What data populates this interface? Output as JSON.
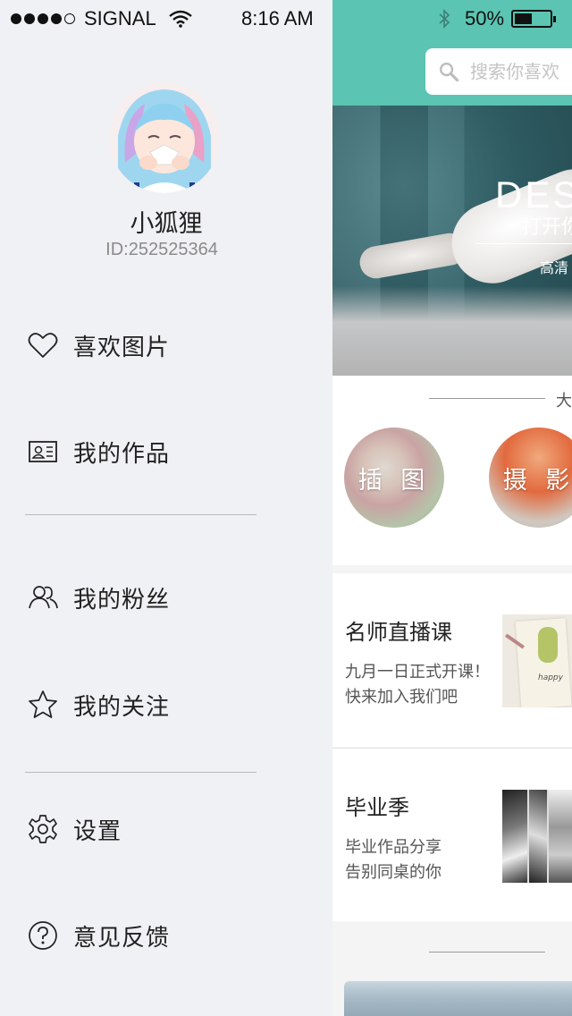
{
  "status_bar": {
    "carrier": "SIGNAL",
    "time": "8:16 AM",
    "battery": "50%",
    "battery_level": 0.5
  },
  "drawer": {
    "username": "小狐狸",
    "user_id": "ID:252525364",
    "menu": [
      {
        "label": "喜欢图片",
        "icon": "heart-icon"
      },
      {
        "label": "我的作品",
        "icon": "id-card-icon"
      },
      {
        "label": "我的粉丝",
        "icon": "people-icon"
      },
      {
        "label": "我的关注",
        "icon": "star-icon"
      },
      {
        "label": "设置",
        "icon": "gear-icon"
      },
      {
        "label": "意见反馈",
        "icon": "question-icon"
      }
    ]
  },
  "main": {
    "search_placeholder": "搜索你喜欢",
    "banner": {
      "title": "DES",
      "subtitle": "打开你",
      "small": "高清"
    },
    "categories_header": "大",
    "categories": [
      "插 图",
      "摄 影"
    ],
    "cards": [
      {
        "title": "名师直播课",
        "line1": "九月一日正式开课！",
        "line2": "快来加入我们吧",
        "thumb_text": "happy"
      },
      {
        "title": "毕业季",
        "line1": "毕业作品分享",
        "line2": "告别同桌的你"
      }
    ]
  },
  "colors": {
    "accent": "#5bc4b2",
    "drawer_bg": "#f0f1f4"
  }
}
